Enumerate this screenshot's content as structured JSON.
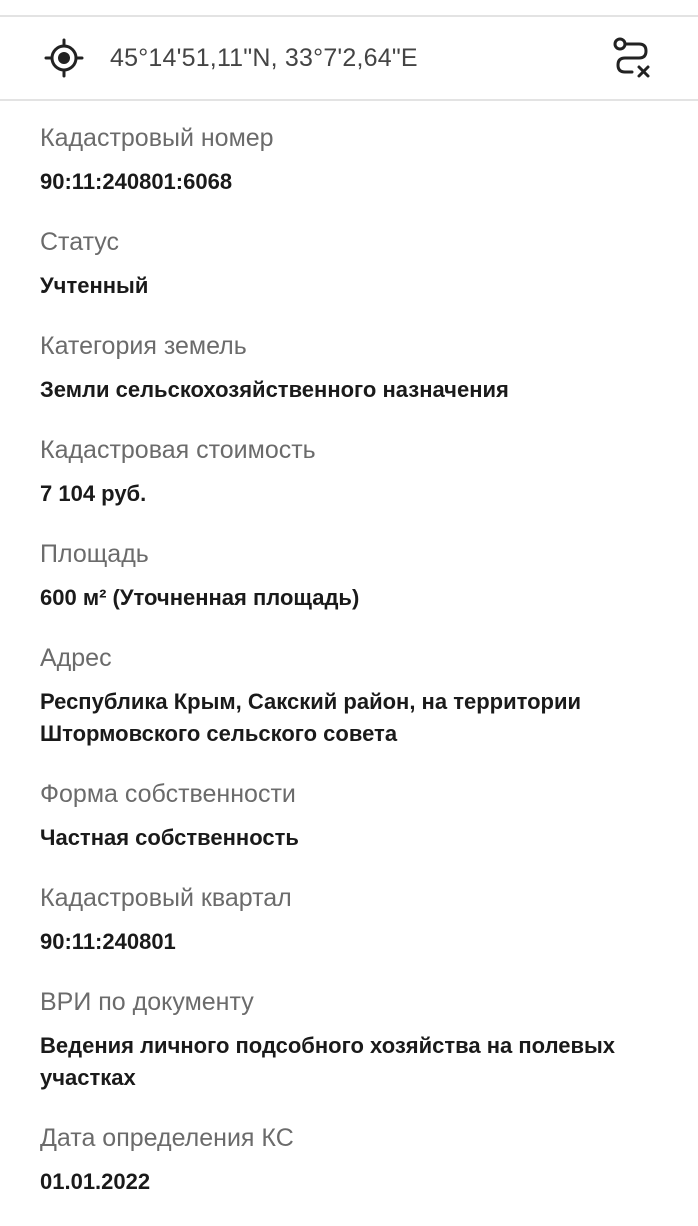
{
  "coordinates": {
    "text": "45°14'51,11\"N, 33°7'2,64\"E",
    "locate_icon": "crosshair-locate-icon",
    "route_icon": "route-clear-icon"
  },
  "fields": [
    {
      "label": "Кадастровый номер",
      "value": "90:11:240801:6068"
    },
    {
      "label": "Статус",
      "value": "Учтенный"
    },
    {
      "label": "Категория земель",
      "value": "Земли сельскохозяйственного назначения"
    },
    {
      "label": "Кадастровая стоимость",
      "value": "7 104 руб."
    },
    {
      "label": "Площадь",
      "value": "600 м² (Уточненная площадь)"
    },
    {
      "label": "Адрес",
      "value": "Республика Крым, Сакский район, на территории Штормовского сельского совета"
    },
    {
      "label": "Форма собственности",
      "value": "Частная собственность"
    },
    {
      "label": "Кадастровый квартал",
      "value": "90:11:240801"
    },
    {
      "label": "ВРИ по документу",
      "value": "Ведения личного подсобного хозяйства на полевых участках"
    },
    {
      "label": "Дата определения КС",
      "value": "01.01.2022"
    }
  ],
  "colors": {
    "label": "#6b6b6b",
    "value": "#1a1a1a",
    "divider": "#e3e3e3"
  }
}
